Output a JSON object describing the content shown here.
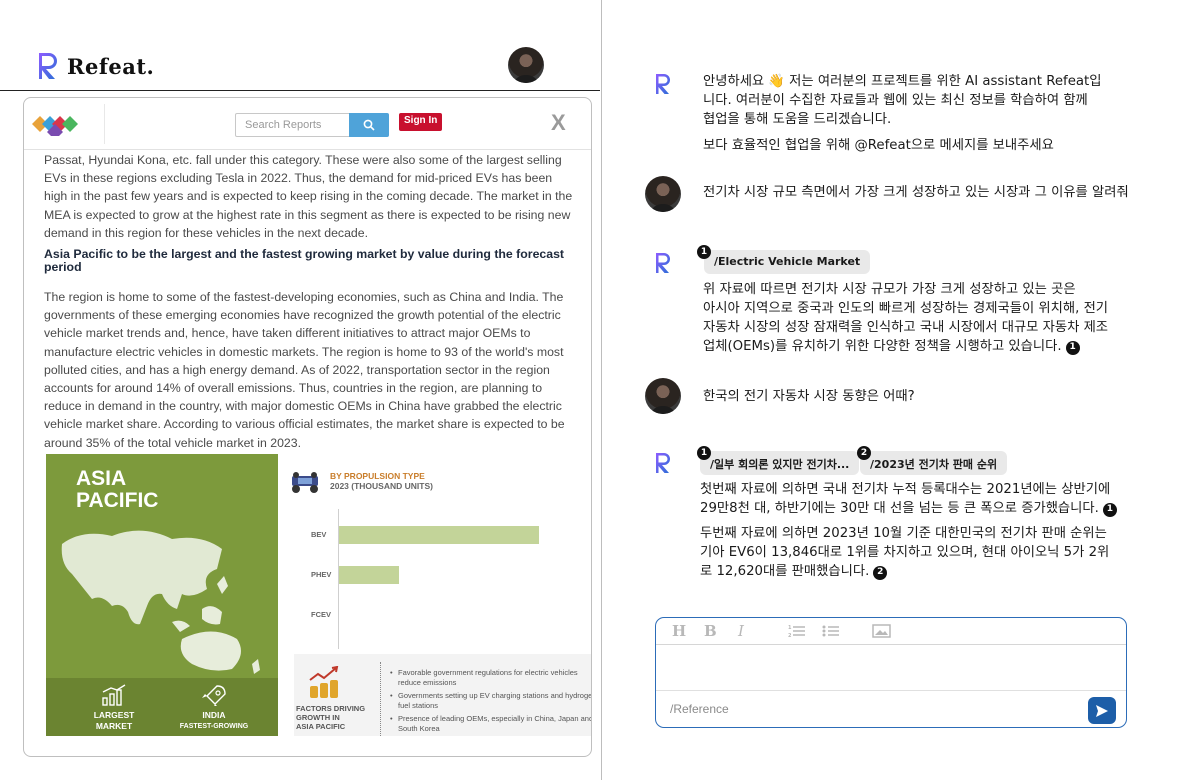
{
  "app": {
    "brand_name": "Refeat."
  },
  "document": {
    "search_placeholder": "Search Reports",
    "sign_in_label": "Sign In",
    "close_label": "X",
    "paragraph1": "Passat, Hyundai Kona, etc. fall under this category. These were also some of the largest selling EVs in these regions excluding Tesla in 2022. Thus, the demand for mid-priced EVs has been high in the past few years and is expected to keep rising in the coming decade. The market in the MEA is expected to grow at the highest rate in this segment as there is expected to be rising new demand in this region for these vehicles in the next decade.",
    "heading": "Asia Pacific to be the largest and the fastest growing market by value during the forecast period",
    "paragraph2": "The region is home to some of the fastest-developing economies, such as China and India. The governments of these emerging economies have recognized the growth potential of the electric vehicle market trends and, hence, have taken different initiatives to attract major OEMs to manufacture electric vehicles in domestic markets. The region is home to 93 of the world's most polluted cities, and has a high energy demand. As of 2022, transportation sector in the region accounts for around 14% of overall emissions. Thus, countries in the region, are planning to reduce in demand in the country, with major domestic OEMs in China have grabbed the electric vehicle market share. According to various official estimates, the market share is expected to be around 35% of the total vehicle market in 2023.",
    "infographic": {
      "region_title_line1": "ASIA",
      "region_title_line2": "PACIFIC",
      "chart_title_line1": "BY PROPULSION TYPE",
      "chart_title_line2": "2023 (THOUSAND UNITS)",
      "bottom_left_1_line1": "LARGEST",
      "bottom_left_1_line2": "MARKET",
      "bottom_left_2_line1": "INDIA",
      "bottom_left_2_line2": "FASTEST-GROWING",
      "factors_label_line1": "FACTORS DRIVING",
      "factors_label_line2": "GROWTH IN",
      "factors_label_line3": "ASIA PACIFIC",
      "factors": [
        "Favorable government regulations for electric vehicles reduce emissions",
        "Governments setting up EV charging stations and hydrogen fuel stations",
        "Presence of leading OEMs, especially in China, Japan and South Korea"
      ]
    }
  },
  "chart_data": {
    "type": "bar",
    "title": "BY PROPULSION TYPE 2023 (THOUSAND UNITS)",
    "categories": [
      "BEV",
      "PHEV",
      "FCEV"
    ],
    "values": [
      100,
      30,
      0
    ],
    "value_scale": "relative (no axis values printed)"
  },
  "chat": {
    "welcome_line1": "안녕하세요 👋 저는 여러분의 프로젝트를 위한 AI assistant Refeat입",
    "welcome_line2": "니다. 여러분이 수집한 자료들과 웹에 있는 최신 정보를 학습하여 함께",
    "welcome_line3": "협업을 통해 도움을 드리겠습니다.",
    "welcome_line4": "보다 효율적인 협업을 위해 @Refeat으로 메세지를 보내주세요",
    "user_msg1": "전기차 시장 규모 측면에서 가장 크게 성장하고 있는 시장과 그 이유를 알려줘",
    "bot_msg1_ref_num": "1",
    "bot_msg1_ref": "/Electric Vehicle Market",
    "bot_msg1_line1": "위 자료에 따르면 전기차 시장 규모가 가장 크게 성장하고 있는 곳은",
    "bot_msg1_line2": "아시아 지역으로 중국과 인도의 빠르게 성장하는 경제국들이 위치해, 전기",
    "bot_msg1_line3": "자동차 시장의 성장 잠재력을 인식하고 국내 시장에서 대규모 자동차 제조",
    "bot_msg1_line4": "업체(OEMs)를 유치하기 위한 다양한 정책을 시행하고 있습니다.",
    "bot_msg1_cite": "1",
    "user_msg2": "한국의 전기 자동차 시장 동향은 어때?",
    "bot_msg2_ref1_num": "1",
    "bot_msg2_ref1": "/일부 회의론 있지만 전기차...",
    "bot_msg2_ref2_num": "2",
    "bot_msg2_ref2": "/2023년 전기차 판매 순위",
    "bot_msg2_p1_line1": "첫번째 자료에 의하면 국내 전기차 누적 등록대수는 2021년에는 상반기에",
    "bot_msg2_p1_line2": "29만8천 대, 하반기에는 30만 대 선을 넘는 등 큰 폭으로 증가했습니다.",
    "bot_msg2_p1_cite": "1",
    "bot_msg2_p2_line1": "두번째 자료에 의하면 2023년 10월 기준 대한민국의 전기차 판매 순위는",
    "bot_msg2_p2_line2": "기아 EV6이 13,846대로 1위를 차지하고 있으며, 현대 아이오닉 5가 2위",
    "bot_msg2_p2_line3": "로 12,620대를 판매했습니다.",
    "bot_msg2_p2_cite": "2"
  },
  "composer": {
    "toolbar": {
      "heading": "H",
      "bold": "B",
      "italic": "I"
    },
    "placeholder": "/Reference"
  },
  "colors": {
    "brand_gradient_start": "#7b5cff",
    "brand_gradient_end": "#2b6fd6",
    "accent_blue": "#1d5ea8",
    "signin_red": "#c8102e",
    "infographic_green": "#7d9a3c",
    "bar_green": "#c3d499"
  }
}
